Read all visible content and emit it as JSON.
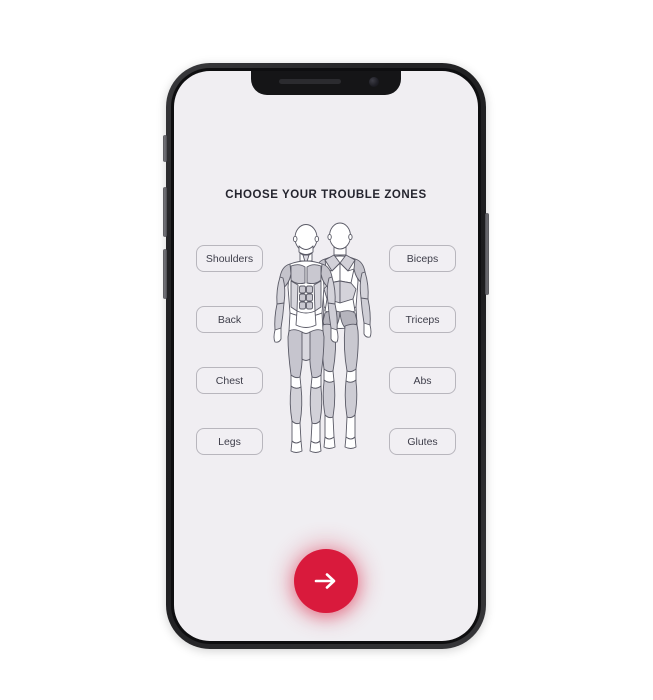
{
  "app": {
    "screen_title": "CHOOSE YOUR TROUBLE ZONES",
    "accent_color": "#d91a3c",
    "screen_background": "#f0eef2",
    "page_background": "#ffffff",
    "frame_color": "#1c1c1e"
  },
  "zones": {
    "left": [
      {
        "label": "Shoulders",
        "name": "zone-button-shoulders"
      },
      {
        "label": "Back",
        "name": "zone-button-back"
      },
      {
        "label": "Chest",
        "name": "zone-button-chest"
      },
      {
        "label": "Legs",
        "name": "zone-button-legs"
      }
    ],
    "right": [
      {
        "label": "Biceps",
        "name": "zone-button-biceps"
      },
      {
        "label": "Triceps",
        "name": "zone-button-triceps"
      },
      {
        "label": "Abs",
        "name": "zone-button-abs"
      },
      {
        "label": "Glutes",
        "name": "zone-button-glutes"
      }
    ]
  },
  "illustration": {
    "icon": "anatomy-muscle-figures",
    "figures": [
      "front-body-muscle-map",
      "back-body-muscle-map"
    ],
    "muscle_fill": "#c9c8cf",
    "outline_color": "#5a5a66"
  },
  "continue": {
    "icon": "arrow-right-icon",
    "label": ""
  },
  "hardware": {
    "notch": "notch",
    "speaker": "earpiece-speaker",
    "camera": "front-camera",
    "silent_switch": "silent-switch",
    "volume_up": "volume-up-button",
    "volume_down": "volume-down-button",
    "power": "power-button"
  }
}
